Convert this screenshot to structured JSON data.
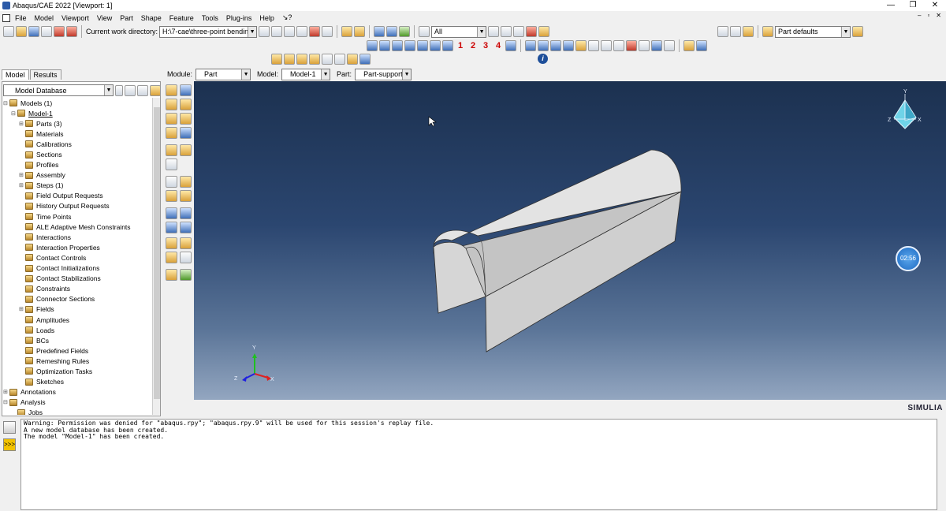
{
  "window": {
    "title": "Abaqus/CAE 2022 [Viewport: 1]",
    "controls": [
      "—",
      "❐",
      "✕"
    ]
  },
  "menu": {
    "items": [
      "File",
      "Model",
      "Viewport",
      "View",
      "Part",
      "Shape",
      "Feature",
      "Tools",
      "Plug-ins",
      "Help",
      "↘?"
    ]
  },
  "toolbar": {
    "cwd_label": "Current work directory:",
    "cwd_value": "H:\\7-cae\\three-point bending",
    "select_value": "All",
    "view_numbers": [
      "1",
      "2",
      "3",
      "4"
    ],
    "part_defaults": "Part defaults"
  },
  "context": {
    "module_label": "Module:",
    "module_value": "Part",
    "model_label": "Model:",
    "model_value": "Model-1",
    "part_label": "Part:",
    "part_value": "Part-support"
  },
  "left": {
    "tabs": [
      "Model",
      "Results"
    ],
    "db": "Model Database",
    "tree": [
      {
        "label": "Models (1)",
        "level": 0,
        "exp": "⊟"
      },
      {
        "label": "Model-1",
        "level": 1,
        "exp": "⊟"
      },
      {
        "label": "Parts (3)",
        "level": 2,
        "exp": "⊞"
      },
      {
        "label": "Materials",
        "level": 2,
        "exp": ""
      },
      {
        "label": "Calibrations",
        "level": 2,
        "exp": ""
      },
      {
        "label": "Sections",
        "level": 2,
        "exp": ""
      },
      {
        "label": "Profiles",
        "level": 2,
        "exp": ""
      },
      {
        "label": "Assembly",
        "level": 2,
        "exp": "⊞"
      },
      {
        "label": "Steps (1)",
        "level": 2,
        "exp": "⊞"
      },
      {
        "label": "Field Output Requests",
        "level": 2,
        "exp": ""
      },
      {
        "label": "History Output Requests",
        "level": 2,
        "exp": ""
      },
      {
        "label": "Time Points",
        "level": 2,
        "exp": ""
      },
      {
        "label": "ALE Adaptive Mesh Constraints",
        "level": 2,
        "exp": ""
      },
      {
        "label": "Interactions",
        "level": 2,
        "exp": ""
      },
      {
        "label": "Interaction Properties",
        "level": 2,
        "exp": ""
      },
      {
        "label": "Contact Controls",
        "level": 2,
        "exp": ""
      },
      {
        "label": "Contact Initializations",
        "level": 2,
        "exp": ""
      },
      {
        "label": "Contact Stabilizations",
        "level": 2,
        "exp": ""
      },
      {
        "label": "Constraints",
        "level": 2,
        "exp": ""
      },
      {
        "label": "Connector Sections",
        "level": 2,
        "exp": ""
      },
      {
        "label": "Fields",
        "level": 2,
        "exp": "⊞"
      },
      {
        "label": "Amplitudes",
        "level": 2,
        "exp": ""
      },
      {
        "label": "Loads",
        "level": 2,
        "exp": ""
      },
      {
        "label": "BCs",
        "level": 2,
        "exp": ""
      },
      {
        "label": "Predefined Fields",
        "level": 2,
        "exp": ""
      },
      {
        "label": "Remeshing Rules",
        "level": 2,
        "exp": ""
      },
      {
        "label": "Optimization Tasks",
        "level": 2,
        "exp": ""
      },
      {
        "label": "Sketches",
        "level": 2,
        "exp": ""
      },
      {
        "label": "Annotations",
        "level": 0,
        "exp": "⊞"
      },
      {
        "label": "Analysis",
        "level": 0,
        "exp": "⊟"
      },
      {
        "label": "Jobs",
        "level": 1,
        "exp": ""
      }
    ]
  },
  "viewport": {
    "triad_top": {
      "y": "Y",
      "x": "X",
      "z": "Z"
    },
    "triad_bottom": {
      "y": "Y",
      "x": "X",
      "z": "Z"
    },
    "timer": "02:56",
    "brand": "SIMULIA"
  },
  "messages": [
    "Warning: Permission was denied for \"abaqus.rpy\"; \"abaqus.rpy.9\" will be used for this session's replay file.",
    "A new model database has been created.",
    "The model \"Model-1\" has been created."
  ],
  "colors": {
    "viewport_top": "#1c3150",
    "viewport_bottom": "#93a6c0",
    "part": "#d9d9d9"
  }
}
